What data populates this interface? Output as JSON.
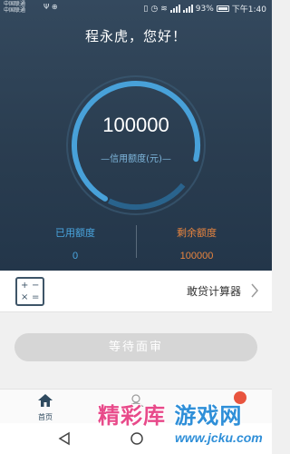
{
  "status_bar": {
    "carrier_1": "中国联通",
    "carrier_2": "中国联通",
    "battery": "93%",
    "time": "下午1:40"
  },
  "greeting": "程永虎，您好！",
  "credit": {
    "amount": "100000",
    "label": "—信用额度(元)—"
  },
  "stats": {
    "used_label": "已用额度",
    "used_value": "0",
    "remaining_label": "剩余额度",
    "remaining_value": "100000"
  },
  "calculator": {
    "title": "敢贷计算器",
    "icon": "calculator-icon"
  },
  "action_button": "等待面审",
  "tabbar": {
    "home_label": "首页"
  },
  "watermark": {
    "text_part1": "精彩库",
    "text_part2": "游戏网",
    "url": "www.jcku.com"
  },
  "colors": {
    "hero_bg": "#2f4558",
    "used_color": "#4aa6e0",
    "remaining_color": "#e8843e",
    "button_disabled": "#d6d6d6"
  }
}
